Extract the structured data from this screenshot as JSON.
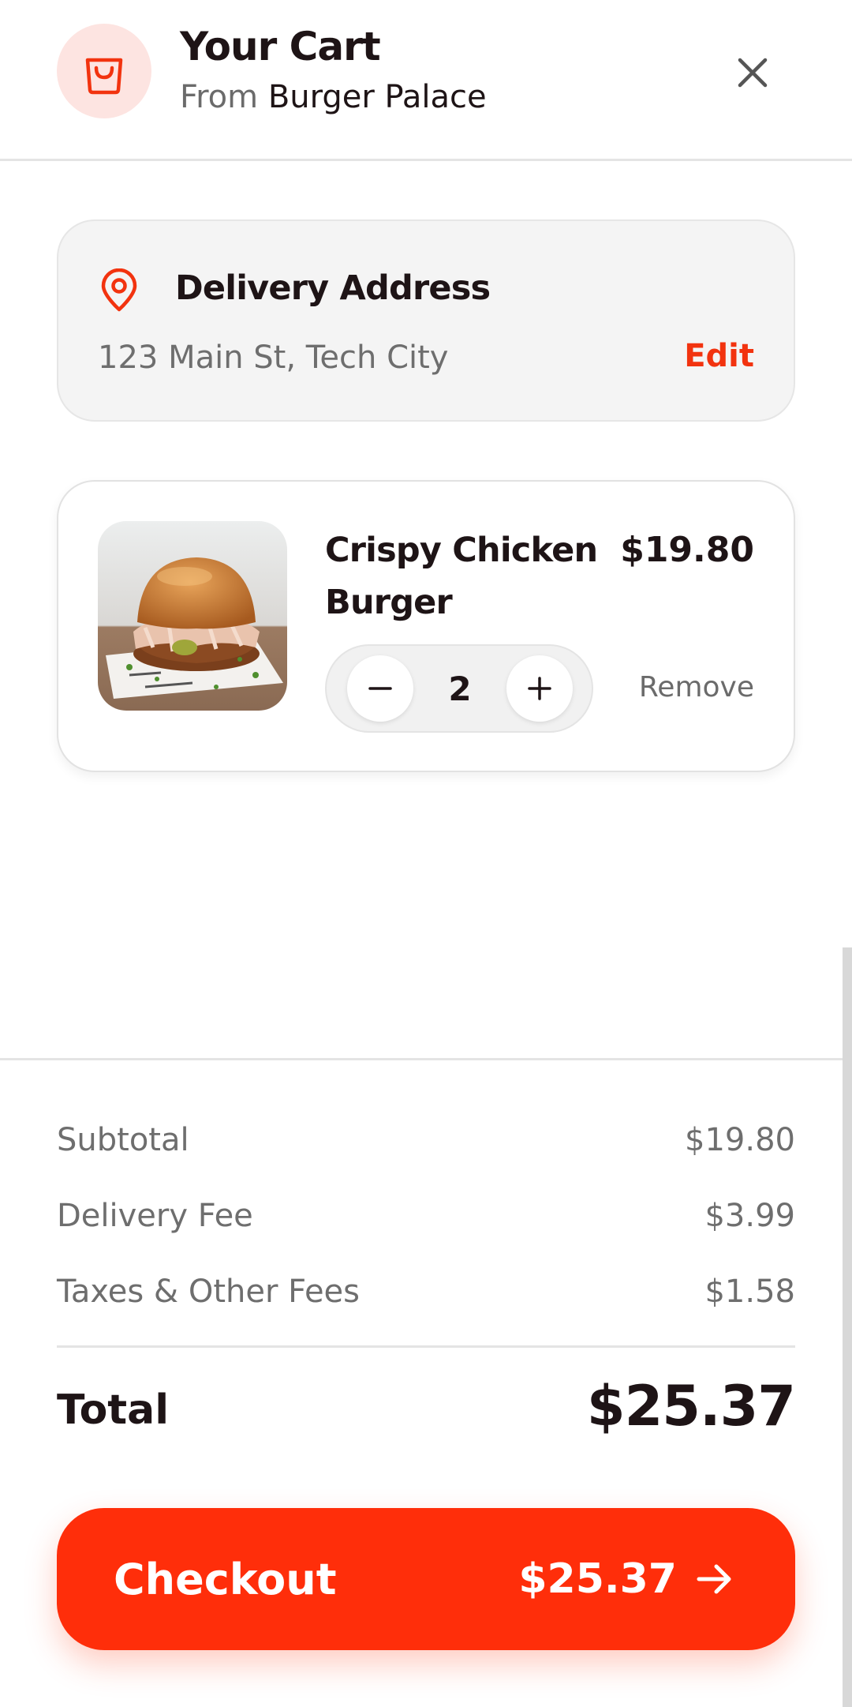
{
  "header": {
    "title": "Your Cart",
    "from_prefix": "From",
    "restaurant": "Burger Palace",
    "icon": "shopping-bag-icon",
    "close_icon": "close-icon"
  },
  "address": {
    "title": "Delivery Address",
    "line": "123 Main St, Tech City",
    "edit_label": "Edit",
    "icon": "map-pin-icon"
  },
  "item": {
    "name": "Crispy Chicken Burger",
    "price": "$19.80",
    "quantity": "2",
    "remove_label": "Remove",
    "image": "crispy-chicken-burger-photo"
  },
  "summary": {
    "subtotal_label": "Subtotal",
    "subtotal_value": "$19.80",
    "delivery_label": "Delivery Fee",
    "delivery_value": "$3.99",
    "taxes_label": "Taxes & Other Fees",
    "taxes_value": "$1.58",
    "total_label": "Total",
    "total_value": "$25.37"
  },
  "checkout": {
    "label": "Checkout",
    "total": "$25.37",
    "icon": "arrow-right-icon"
  },
  "colors": {
    "accent": "#ff2e0a",
    "accent_light": "#fde4e1",
    "text": "#1e1416",
    "muted": "#6e6e6e"
  }
}
